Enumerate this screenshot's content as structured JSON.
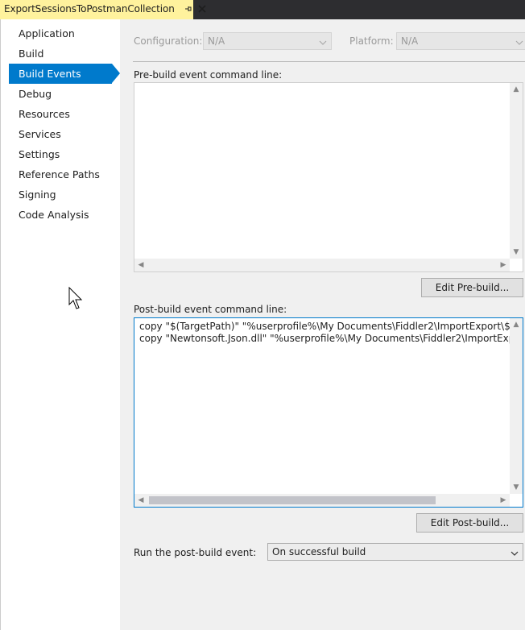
{
  "tab": {
    "title": "ExportSessionsToPostmanCollection"
  },
  "nav": {
    "items": [
      {
        "label": "Application",
        "active": false
      },
      {
        "label": "Build",
        "active": false
      },
      {
        "label": "Build Events",
        "active": true
      },
      {
        "label": "Debug",
        "active": false
      },
      {
        "label": "Resources",
        "active": false
      },
      {
        "label": "Services",
        "active": false
      },
      {
        "label": "Settings",
        "active": false
      },
      {
        "label": "Reference Paths",
        "active": false
      },
      {
        "label": "Signing",
        "active": false
      },
      {
        "label": "Code Analysis",
        "active": false
      }
    ]
  },
  "config": {
    "configuration_label": "Configuration:",
    "configuration_value": "N/A",
    "platform_label": "Platform:",
    "platform_value": "N/A"
  },
  "prebuild": {
    "label": "Pre-build event command line:",
    "lines": [],
    "edit_button": "Edit Pre-build..."
  },
  "postbuild": {
    "label": "Post-build event command line:",
    "lines": [
      "copy \"$(TargetPath)\" \"%userprofile%\\My Documents\\Fiddler2\\ImportExport\\$(TargetF",
      "copy \"Newtonsoft.Json.dll\" \"%userprofile%\\My Documents\\Fiddler2\\ImportExport\\Ne"
    ],
    "edit_button": "Edit Post-build..."
  },
  "run_post_build": {
    "label": "Run the post-build event:",
    "value": "On successful build"
  },
  "colors": {
    "accent": "#007acc",
    "tab_active": "#fff29d",
    "panel_bg": "#f0f0f0"
  }
}
